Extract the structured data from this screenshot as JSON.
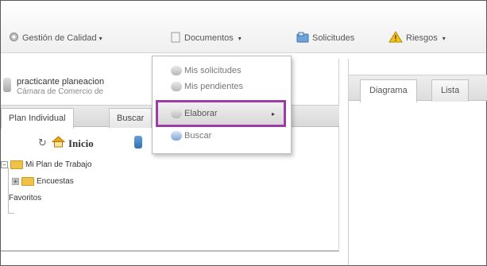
{
  "menubar": {
    "items": [
      {
        "label": "Gestión de Calidad",
        "has_caret": true
      },
      {
        "label": "Documentos",
        "has_caret": true
      },
      {
        "label": "Solicitudes",
        "has_caret": false
      },
      {
        "label": "Riesgos",
        "has_caret": true
      }
    ],
    "caret": "▾"
  },
  "user": {
    "name": "practicante planeacion",
    "org": "Cámara de Comercio de"
  },
  "left_tabs": [
    "Plan Individual",
    "Buscar"
  ],
  "toolbar": {
    "home_label": "Inicio"
  },
  "tree": {
    "root": "Mi Plan de Trabajo",
    "expander": "⊞",
    "child": "Encuestas",
    "favorites": "Favoritos"
  },
  "right_tabs": [
    "Diagrama",
    "Lista"
  ],
  "dropdown": {
    "items": [
      {
        "label": "Mis solicitudes"
      },
      {
        "label": "Mis pendientes"
      },
      {
        "label": "Elaborar",
        "has_submenu": true,
        "highlighted": true
      },
      {
        "label": "Buscar"
      }
    ],
    "submenu_arrow": "▸",
    "highlight_color": "#9b3ea3"
  }
}
